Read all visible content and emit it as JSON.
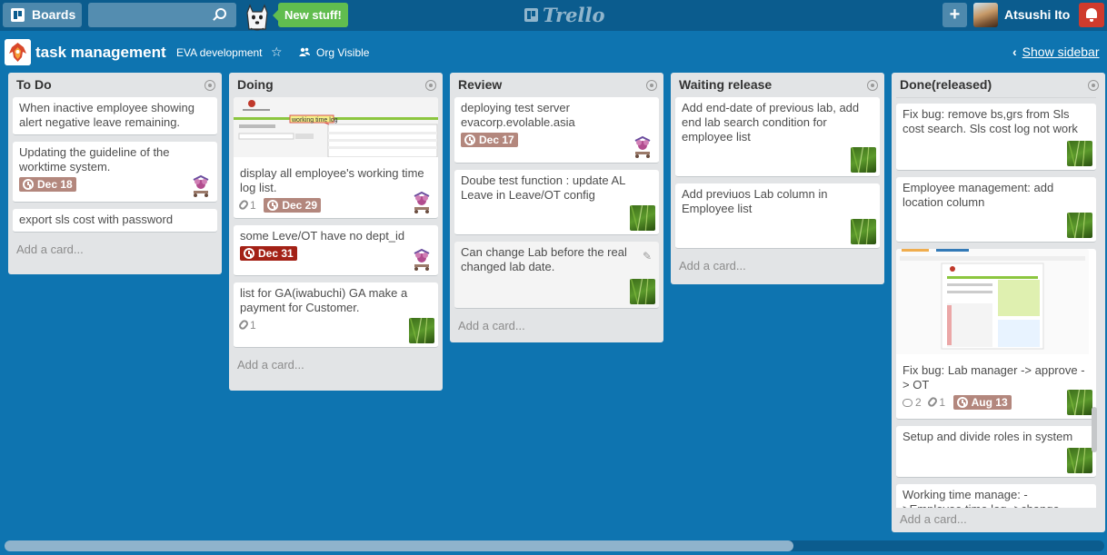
{
  "header": {
    "boards_label": "Boards",
    "search": {
      "value": "",
      "placeholder": ""
    },
    "new_stuff_label": "New stuff!",
    "logo_text": "Trello",
    "add_label": "+",
    "user_name": "Atsushi Ito"
  },
  "board": {
    "title": "task management",
    "organization": "EVA development",
    "visibility": "Org Visible",
    "show_sidebar_label": "Show sidebar"
  },
  "lists": [
    {
      "title": "To Do",
      "add_card_label": "Add a card...",
      "cards": [
        {
          "title": "When inactive employee showing alert negative leave remaining."
        },
        {
          "title": "Updating the guideline of the worktime system.",
          "due": "Dec 18",
          "member": "flower-avatar"
        },
        {
          "title": "export sls cost with password"
        }
      ]
    },
    {
      "title": "Doing",
      "add_card_label": "Add a card...",
      "cards": [
        {
          "title": "display all employee's working time log list.",
          "cover": "working-time-log-screenshot",
          "cover_text": "working time log",
          "attachments": "1",
          "due": "Dec 29",
          "member": "flower-avatar"
        },
        {
          "title": "some Leve/OT have no dept_id",
          "due": "Dec 31",
          "member": "flower-avatar"
        },
        {
          "title": "list for GA(iwabuchi) GA make a payment for Customer.",
          "attachments": "1",
          "member": "bamboo-avatar"
        }
      ]
    },
    {
      "title": "Review",
      "add_card_label": "Add a card...",
      "cards": [
        {
          "title": "deploying test server evacorp.evolable.asia",
          "due": "Dec 17",
          "member": "flower-avatar"
        },
        {
          "title": "Doube test function : update AL Leave in Leave/OT config",
          "member": "bamboo-avatar"
        },
        {
          "title": "Can change Lab before the real changed lab date.",
          "member": "bamboo-avatar"
        }
      ]
    },
    {
      "title": "Waiting release",
      "add_card_label": "Add a card...",
      "cards": [
        {
          "title": "Add end-date of previous lab, add end lab search condition for employee list",
          "member": "bamboo-avatar"
        },
        {
          "title": "Add previuos Lab column in Employee list",
          "member": "bamboo-avatar"
        }
      ]
    },
    {
      "title": "Done(released)",
      "add_card_label": "Add a card...",
      "cards": [
        {
          "title": "Fix bug: remove bs,grs from Sls cost search. Sls cost log not work",
          "member": "bamboo-avatar"
        },
        {
          "title": "Employee management: add location column",
          "member": "bamboo-avatar"
        },
        {
          "title": "Fix bug: Lab manager -> approve -> OT",
          "cover": "lab-approve-screenshot",
          "comments": "2",
          "attachments": "1",
          "due": "Aug 13",
          "member": "bamboo-avatar"
        },
        {
          "title": "Setup and divide roles in system",
          "member": "bamboo-avatar"
        },
        {
          "title": "Working time manage: ->Employee time log ->change username filter"
        }
      ]
    }
  ],
  "colors": {
    "board_bg": "#0e74b0",
    "header_bg": "#0b5c8e",
    "due_soon": "#b3877d",
    "due_past": "#a32116",
    "new_stuff": "#61bd4f",
    "notification": "#cf3b2d"
  }
}
